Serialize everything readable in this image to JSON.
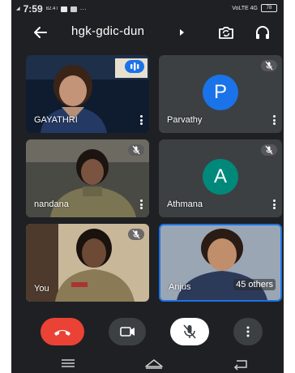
{
  "status_bar": {
    "time": "7:59",
    "net_speed": "82.4 KB/S",
    "right_text": "VoLTE 4G",
    "battery": "78"
  },
  "header": {
    "meeting_code": "hgk-gdic-dun"
  },
  "tiles": [
    {
      "name": "GAYATHRI",
      "state": "speaking"
    },
    {
      "name": "Parvathy",
      "avatar_letter": "P",
      "avatar_color": "#1a73e8",
      "state": "muted"
    },
    {
      "name": "nandana",
      "state": "muted"
    },
    {
      "name": "Athmana",
      "avatar_letter": "A",
      "avatar_color": "#00897b",
      "state": "muted"
    },
    {
      "name": "You",
      "state": "muted"
    },
    {
      "name": "Anjus",
      "state": "normal"
    }
  ],
  "others_label": "45 others",
  "colors": {
    "background": "#1f2023",
    "tile": "#3c4043",
    "accent": "#1a73e8",
    "end_call": "#ea4335"
  },
  "icons": [
    "back-arrow-icon",
    "switch-camera-icon",
    "headphones-icon",
    "microphone-muted-icon",
    "more-vert-icon",
    "end-call-icon",
    "camera-icon",
    "more-horizontal-icon",
    "home-icon",
    "recents-icon",
    "back-nav-icon"
  ]
}
